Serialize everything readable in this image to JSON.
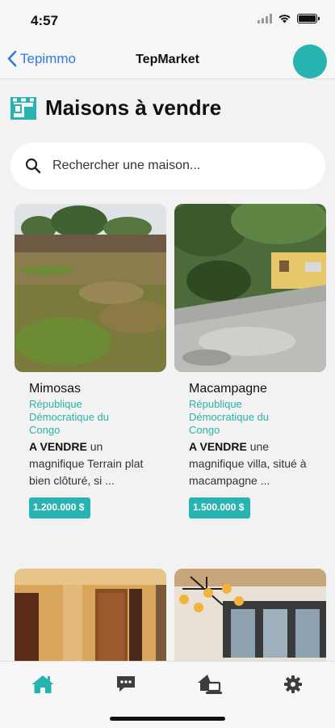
{
  "status_bar": {
    "time": "4:57"
  },
  "nav": {
    "back_label": "Tepimmo",
    "title": "TepMarket"
  },
  "page": {
    "title": "Maisons à vendre"
  },
  "search": {
    "placeholder": "Rechercher une maison..."
  },
  "listings": [
    {
      "name": "Mimosas",
      "location": "République Démocratique du Congo",
      "status": "A VENDRE",
      "description": " un magnifique Terrain plat bien clôturé, si ...",
      "price": "1.200.000 $"
    },
    {
      "name": "Macampagne",
      "location": "République Démocratique du Congo",
      "status": "A VENDRE",
      "description": " une magnifique villa, situé  à macampagne   ...",
      "price": "1.500.000 $"
    }
  ],
  "tabs": [
    {
      "icon": "home-icon",
      "active": true
    },
    {
      "icon": "chat-icon",
      "active": false
    },
    {
      "icon": "house-laptop-icon",
      "active": false
    },
    {
      "icon": "gear-icon",
      "active": false
    }
  ],
  "colors": {
    "accent": "#27b3b0",
    "link": "#2f7ae5",
    "background": "#f2f2f2"
  }
}
